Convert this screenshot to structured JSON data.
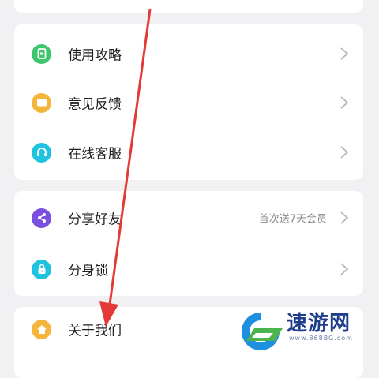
{
  "menu": {
    "group1": [
      {
        "label": "使用攻略",
        "icon": "guide-icon",
        "color": "#3ec66e"
      },
      {
        "label": "意见反馈",
        "icon": "feedback-icon",
        "color": "#f4b63a"
      },
      {
        "label": "在线客服",
        "icon": "headset-icon",
        "color": "#1fc3e0"
      }
    ],
    "group2": [
      {
        "label": "分享好友",
        "icon": "share-icon",
        "color": "#7b4fe0",
        "note": "首次送7天会员"
      },
      {
        "label": "分身锁",
        "icon": "lock-icon",
        "color": "#1fc3e0"
      }
    ],
    "group3": [
      {
        "label": "关于我们",
        "icon": "home-icon",
        "color": "#f4b63a"
      }
    ]
  },
  "annotation": {
    "color": "#e53935"
  },
  "watermark": {
    "title": "速游网",
    "url": "www.868BG.com"
  }
}
